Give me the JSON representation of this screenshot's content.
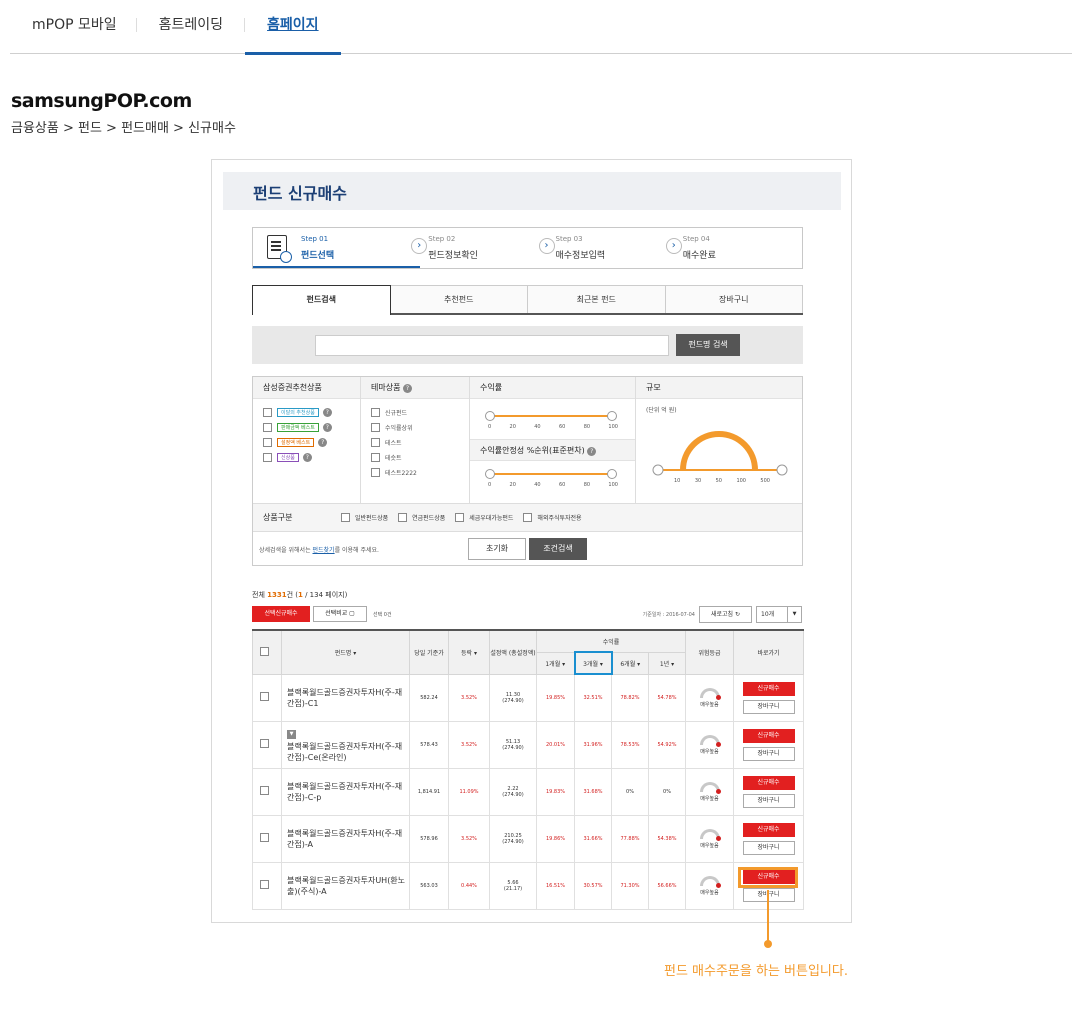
{
  "top_tabs": [
    {
      "label": "mPOP 모바일"
    },
    {
      "label": "홈트레이딩"
    },
    {
      "label": "홈페이지"
    }
  ],
  "site_title": "samsungPOP.com",
  "breadcrumb": "금융상품 > 펀드 > 펀드매매 > 신규매수",
  "page": {
    "title": "펀드 신규매수",
    "steps": [
      {
        "no": "Step 01",
        "label": "펀드선택"
      },
      {
        "no": "Step 02",
        "label": "펀드정보확인"
      },
      {
        "no": "Step 03",
        "label": "매수정보입력"
      },
      {
        "no": "Step 04",
        "label": "매수완료"
      }
    ],
    "sub_tabs": [
      {
        "label": "펀드검색"
      },
      {
        "label": "추천펀드"
      },
      {
        "label": "최근본 펀드"
      },
      {
        "label": "장바구니"
      }
    ],
    "search": {
      "placeholder": "",
      "button": "펀드명 검색"
    },
    "filters": {
      "recommend": {
        "title": "삼성증권추천상품",
        "items": [
          {
            "label": "이달의 추천상품",
            "color": "#2a9ac6"
          },
          {
            "label": "판매금액 베스트",
            "color": "#38a238"
          },
          {
            "label": "설정액 베스트",
            "color": "#e06b00"
          },
          {
            "label": "신상품",
            "color": "#8a4fb8"
          }
        ]
      },
      "theme": {
        "title": "테마상품",
        "items": [
          "신규펀드",
          "수익률상위",
          "테스트",
          "테슷트",
          "테스트2222"
        ]
      },
      "return": {
        "title": "수익률",
        "ticks": [
          "0",
          "20",
          "40",
          "60",
          "80",
          "100"
        ]
      },
      "stability": {
        "title": "수익률안정성 %순위(표준편차)",
        "ticks": [
          "0",
          "20",
          "40",
          "60",
          "80",
          "100"
        ]
      },
      "size": {
        "title": "규모",
        "unit": "(단위 억 원)",
        "ticks": [
          "10",
          "30",
          "50",
          "100",
          "500"
        ]
      },
      "product_type": {
        "title": "상품구분",
        "options": [
          "일반펀드상품",
          "연금펀드상품",
          "세금우대가능펀드",
          "해외주식투자전용"
        ]
      },
      "detail_text_pre": "상세검색을 위해서는 ",
      "detail_link": "펀드찾기",
      "detail_text_post": "를 이용해 주세요.",
      "reset_button": "초기화",
      "search_button": "조건검색"
    },
    "summary": {
      "pre": "전체 ",
      "total": "1331",
      "mid": "건 (",
      "page": "1",
      "post": " / 134 페이지)"
    },
    "buttons": {
      "buy_selected": "선택신규매수",
      "compare": "선택비교",
      "selected_count": "선택 0건",
      "base_date": "기준일자 : 2016-07-04",
      "refresh": "새로고침",
      "page_size": "10개"
    },
    "table": {
      "headers": {
        "name": "펀드명 ▾",
        "nav": "당일 기준가",
        "change": "등락 ▾",
        "amount": "설정액 (총설정액)",
        "returns": "수익률",
        "m1": "1개월 ▾",
        "m3": "3개월 ▾",
        "m6": "6개월 ▾",
        "y1": "1년 ▾",
        "risk": "위험등급",
        "action": "바로가기"
      },
      "rows": [
        {
          "name": "블랙록월드골드증권자투자H(주-재간접)-C1",
          "nav": "582.24",
          "change": "3.52%",
          "amt1": "11.30",
          "amt2": "(274.90)",
          "m1": "19.85%",
          "m3": "32.51%",
          "m6": "78.82%",
          "y1": "54.78%",
          "risk": "매우높음",
          "buy": "신규매수",
          "cart": "장바구니",
          "badge": ""
        },
        {
          "name": "블랙록월드골드증권자투자H(주-재간접)-Ce(온라인)",
          "nav": "578.43",
          "change": "3.52%",
          "amt1": "51.13",
          "amt2": "(274.90)",
          "m1": "20.01%",
          "m3": "31.96%",
          "m6": "78.53%",
          "y1": "54.92%",
          "risk": "매우높음",
          "buy": "신규매수",
          "cart": "장바구니",
          "badge": "▼"
        },
        {
          "name": "블랙록월드골드증권자투자H(주-재간접)-C-p",
          "nav": "1,814.91",
          "change": "11.09%",
          "amt1": "2.22",
          "amt2": "(274.90)",
          "m1": "19.83%",
          "m3": "31.68%",
          "m6": "0%",
          "y1": "0%",
          "risk": "매우높음",
          "buy": "신규매수",
          "cart": "장바구니",
          "badge": ""
        },
        {
          "name": "블랙록월드골드증권자투자H(주-재간접)-A",
          "nav": "578.96",
          "change": "3.52%",
          "amt1": "210.25",
          "amt2": "(274.90)",
          "m1": "19.86%",
          "m3": "31.66%",
          "m6": "77.88%",
          "y1": "54.38%",
          "risk": "매우높음",
          "buy": "신규매수",
          "cart": "장바구니",
          "badge": ""
        },
        {
          "name": "블랙록월드골드증권자투자UH(환노출)(주식)-A",
          "nav": "563.03",
          "change": "0.44%",
          "amt1": "5.66",
          "amt2": "(21.17)",
          "m1": "16.51%",
          "m3": "30.57%",
          "m6": "71.30%",
          "y1": "56.66%",
          "risk": "매우높음",
          "buy": "신규매수",
          "cart": "장바구니",
          "badge": ""
        }
      ]
    }
  },
  "callout": "펀드 매수주문을 하는 버튼입니다."
}
